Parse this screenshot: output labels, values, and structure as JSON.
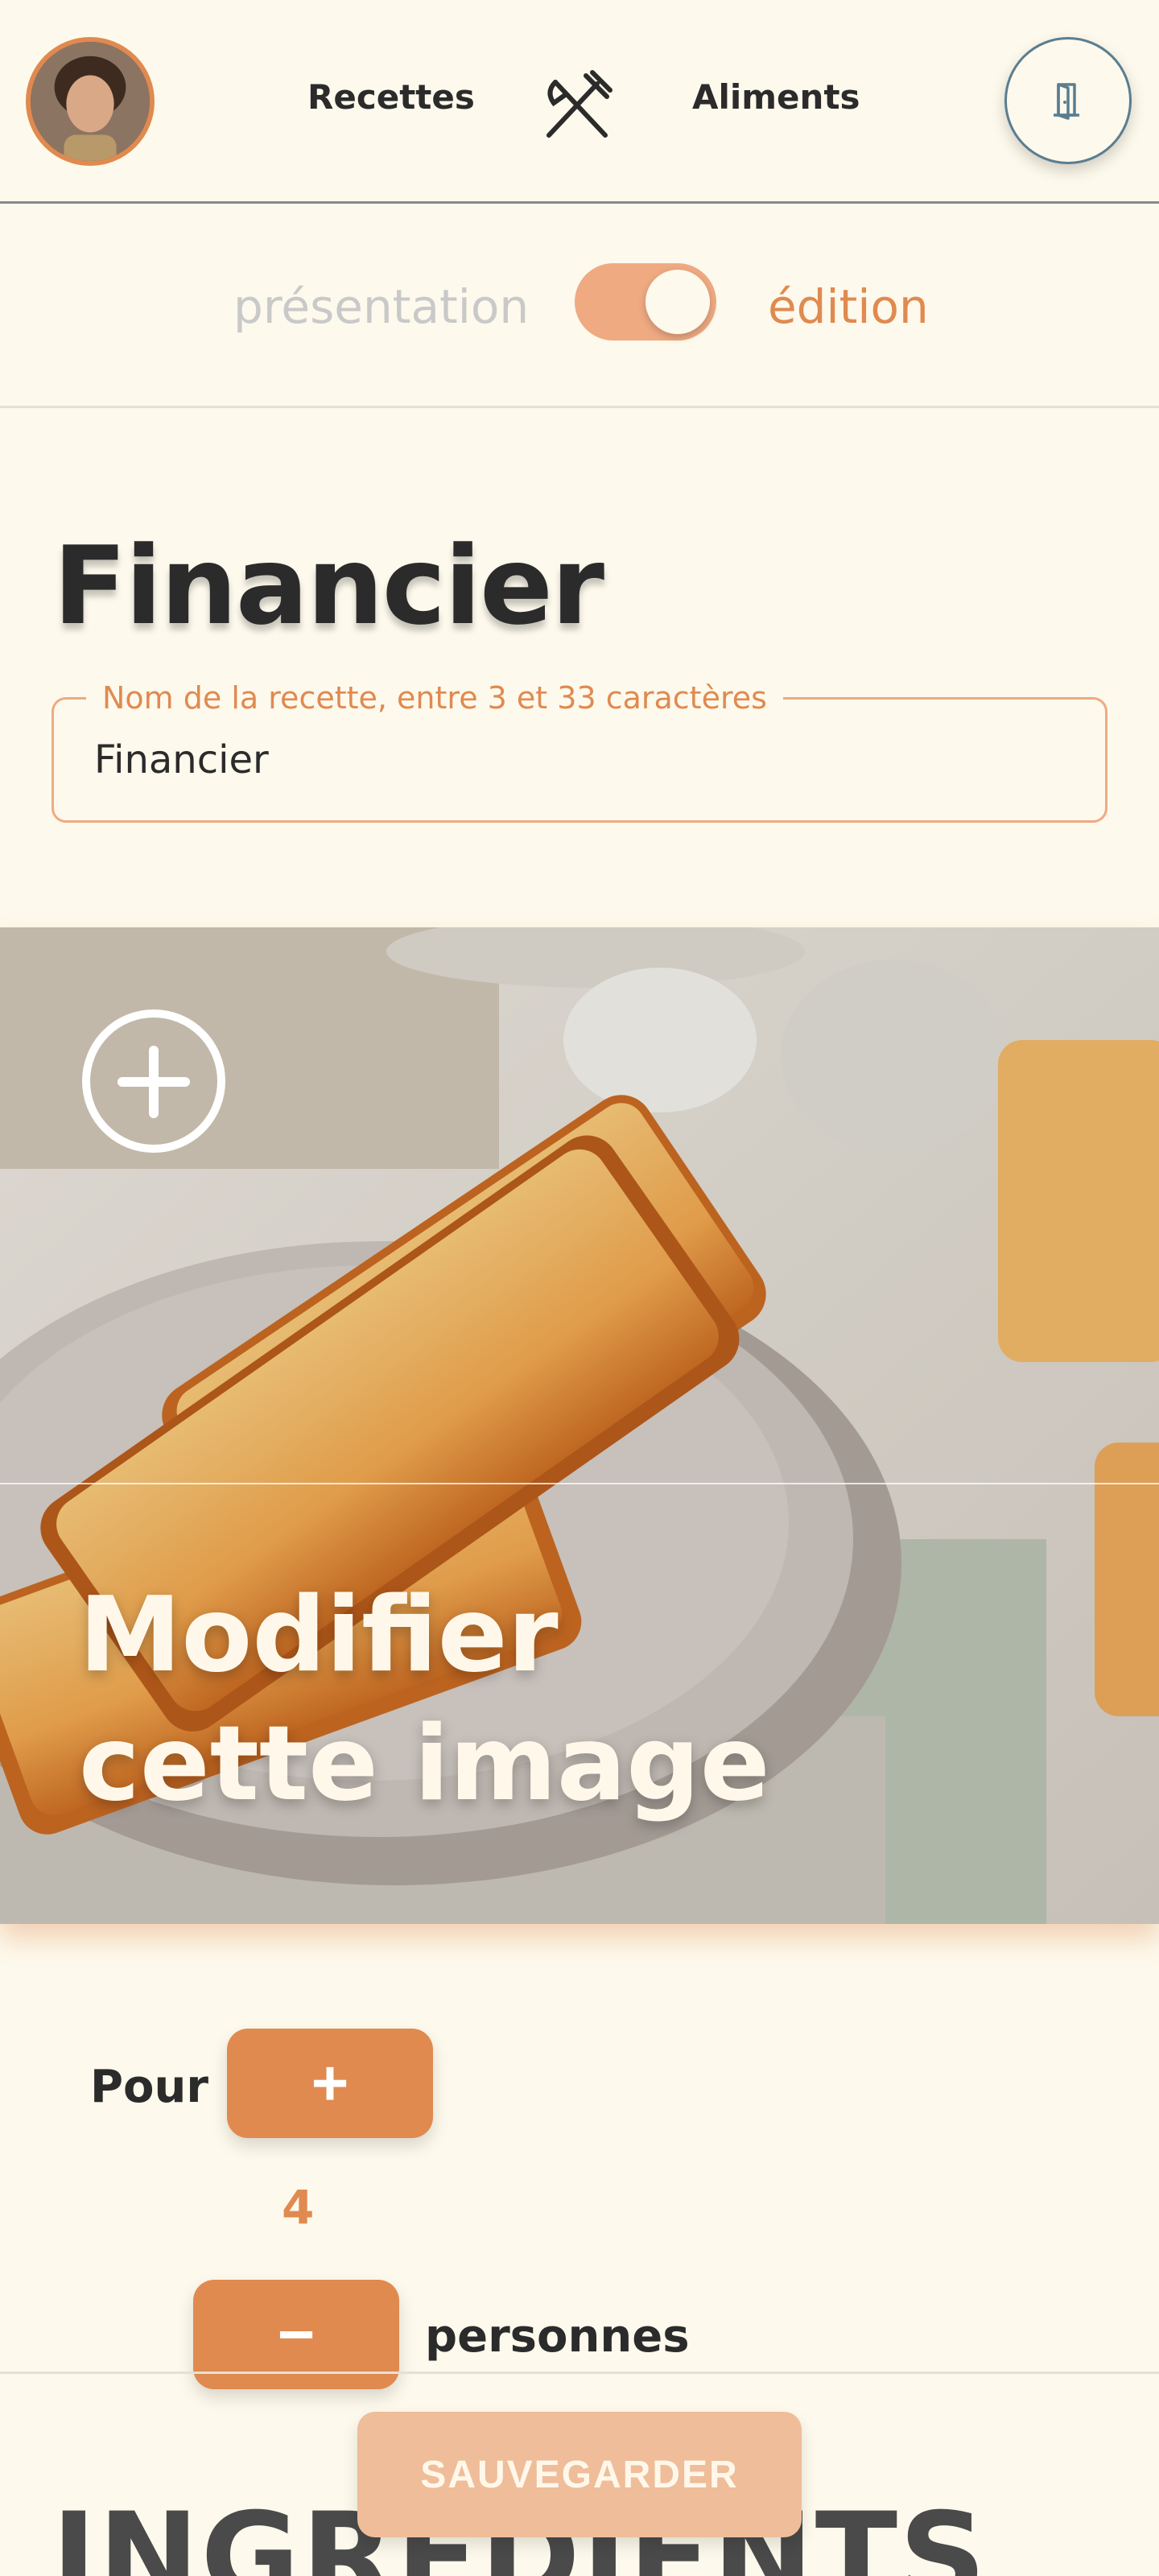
{
  "header": {
    "nav_recettes": "Recettes",
    "nav_aliments": "Aliments",
    "avatar_icon": "user-avatar",
    "logo_icon": "utensils-crossed-icon",
    "logout_icon": "door-exit-icon"
  },
  "mode": {
    "presentation_label": "présentation",
    "edition_label": "édition",
    "active": "édition"
  },
  "recipe": {
    "title": "Financier",
    "name_field_label": "Nom de la recette, entre 3 et 33 caractères",
    "name_value": "Financier"
  },
  "image_section": {
    "edit_label": "Modifier cette image",
    "add_icon": "plus-circle-icon"
  },
  "servings": {
    "pour_label": "Pour",
    "count": "4",
    "unit_label": "personnes",
    "plus_label": "+",
    "minus_label": "−"
  },
  "save_button": "SAUVEGARDER",
  "ingredients_heading": "INGRÉDIENTS",
  "colors": {
    "accent": "#e08a50",
    "accent_light": "#efaa82",
    "background": "#fdf9ec",
    "text": "#2b2b2b"
  }
}
